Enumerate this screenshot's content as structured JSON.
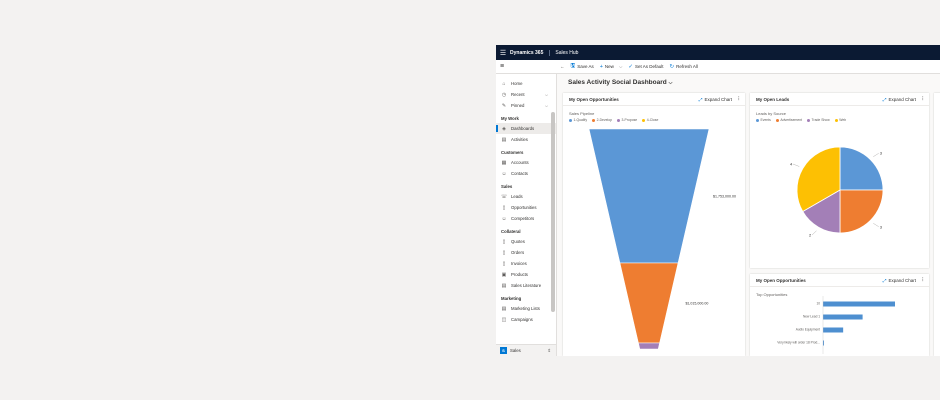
{
  "header": {
    "menu_icon": "waffle-icon",
    "app_name": "Dynamics 365",
    "area_name": "Sales Hub"
  },
  "commands": {
    "save_as": "Save As",
    "new": "New",
    "set_default": "Set As Default",
    "refresh": "Refresh All"
  },
  "sidebar": {
    "home": "Home",
    "recent": "Recent",
    "pinned": "Pinned",
    "groups": {
      "my_work": "My Work",
      "dashboards": "Dashboards",
      "activities": "Activities",
      "customers": "Customers",
      "accounts": "Accounts",
      "contacts": "Contacts",
      "sales": "Sales",
      "leads": "Leads",
      "opportunities": "Opportunities",
      "competitors": "Competitors",
      "collateral": "Collateral",
      "quotes": "Quotes",
      "orders": "Orders",
      "invoices": "Invoices",
      "products": "Products",
      "sales_literature": "Sales Literature",
      "marketing": "Marketing",
      "marketing_lists": "Marketing Lists",
      "campaigns": "Campaigns"
    },
    "area_badge": "S",
    "area_label": "Sales"
  },
  "dashboard": {
    "title": "Sales Activity Social Dashboard"
  },
  "cards": {
    "opportunities": {
      "title": "My Open Opportunities",
      "expand": "Expand Chart",
      "chart_title": "Sales Pipeline"
    },
    "leads": {
      "title": "My Open Leads",
      "expand": "Expand Chart",
      "chart_title": "Leads by Source"
    },
    "top_opps": {
      "title": "My Open Opportunities",
      "expand": "Expand Chart",
      "chart_title": "Top Opportunities"
    }
  },
  "colors": {
    "blue": "#5b97d6",
    "orange": "#ee7d31",
    "purple": "#a37fb7",
    "yellow": "#fdc003",
    "gray": "#6e6e6e"
  },
  "chart_data": [
    {
      "type": "funnel",
      "title": "Sales Pipeline",
      "series": [
        {
          "name": "1-Qualify",
          "value": 1753000,
          "label": "$1,753,000.00",
          "color": "#5b97d6"
        },
        {
          "name": "2-Develop",
          "value": 1015000,
          "label": "$1,015,000.00",
          "color": "#ee7d31"
        },
        {
          "name": "3-Propose",
          "value": 0,
          "label": "",
          "color": "#a37fb7"
        },
        {
          "name": "4-Close",
          "value": 0,
          "label": "",
          "color": "#fdc003"
        }
      ]
    },
    {
      "type": "pie",
      "title": "Leads by Source",
      "slices": [
        {
          "name": "Events",
          "value": 3,
          "label": "3",
          "color": "#5b97d6"
        },
        {
          "name": "Advertisement",
          "value": 3,
          "label": "3",
          "color": "#ee7d31"
        },
        {
          "name": "Trade Show",
          "value": 2,
          "label": "2",
          "color": "#a37fb7"
        },
        {
          "name": "Web",
          "value": 4,
          "label": "4",
          "color": "#fdc003"
        }
      ]
    },
    {
      "type": "bar",
      "title": "Top Opportunities",
      "categories": [
        "10",
        "New Lead 1",
        "Audio Equipment",
        "Very likely will order 18 Prod..."
      ],
      "values": [
        100,
        55,
        28,
        1
      ]
    }
  ]
}
